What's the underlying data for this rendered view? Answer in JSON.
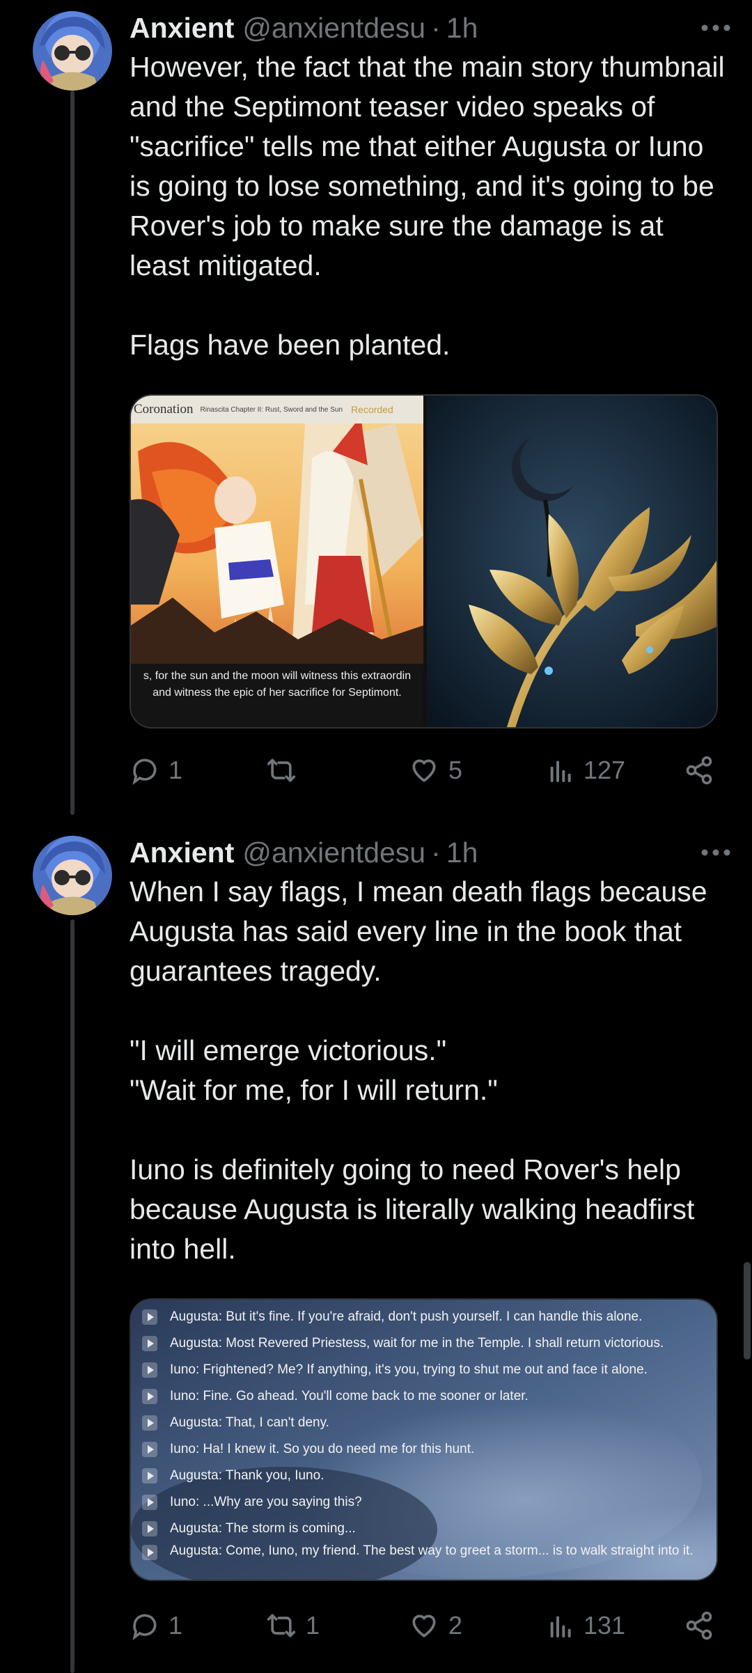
{
  "tweets": [
    {
      "name": "Anxient",
      "handle": "@anxientdesu",
      "separator": "·",
      "time": "1h",
      "text": "However, the fact that the main story thumbnail and the Septimont teaser video speaks of \"sacrifice\" tells me that either Augusta or Iuno is going to lose something, and it's going to be Rover's job to make sure the damage is at least mitigated.\n\nFlags have been planted.",
      "media_left": {
        "title": "Coronation",
        "chapter": "Rinascita Chapter II: Rust, Sword and the Sun",
        "tag": "Recorded",
        "caption_line1": "s, for the sun and the moon will witness this extraordin",
        "caption_line2": "and witness the epic of her sacrifice for Septimont."
      },
      "replies": "1",
      "reposts": "",
      "likes": "5",
      "views": "127"
    },
    {
      "name": "Anxient",
      "handle": "@anxientdesu",
      "separator": "·",
      "time": "1h",
      "text": "When I say flags, I mean death flags because Augusta has said every line in the book that guarantees tragedy.\n\n\"I will emerge victorious.\"\n\"Wait for me, for I will return.\"\n\nIuno is definitely going to need Rover's help because Augusta is literally walking headfirst into hell.",
      "dialog": [
        "Augusta: But it's fine. If you're afraid, don't push yourself. I can handle this alone.",
        "Augusta: Most Revered Priestess, wait for me in the Temple. I shall return victorious.",
        "Iuno: Frightened? Me? If anything, it's you, trying to shut me out and face it alone.",
        "Iuno: Fine. Go ahead. You'll come back to me sooner or later.",
        "Augusta: That, I can't deny.",
        "Iuno: Ha! I knew it. So you do need me for this hunt.",
        "Augusta: Thank you, Iuno.",
        "Iuno: ...Why are you saying this?",
        "Augusta: The storm is coming...",
        "Augusta: Come, Iuno, my friend. The best way to greet a storm... is to walk straight into it."
      ],
      "replies": "1",
      "reposts": "1",
      "likes": "2",
      "views": "131"
    }
  ],
  "icons": {
    "reply": "reply-icon",
    "repost": "repost-icon",
    "like": "heart-icon",
    "views": "views-icon",
    "share": "share-icon",
    "more": "more-icon"
  },
  "colors": {
    "background": "#000000",
    "text": "#e7e9ea",
    "muted": "#71767b",
    "border": "#2f3336"
  }
}
